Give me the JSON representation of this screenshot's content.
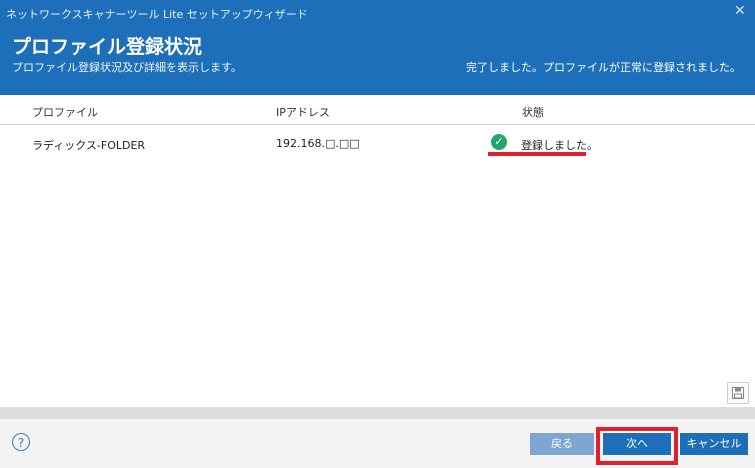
{
  "window": {
    "title": "ネットワークスキャナーツール Lite セットアップウィザード",
    "close_glyph": "✕"
  },
  "header": {
    "title": "プロファイル登録状況",
    "subtitle": "プロファイル登録状況及び詳細を表示します。",
    "status_message": "完了しました。プロファイルが正常に登録されました。"
  },
  "table": {
    "columns": [
      "プロファイル",
      "IPアドレス",
      "状態"
    ],
    "rows": [
      {
        "profile": "ラディックス-FOLDER",
        "ip": "192.168.□.□□",
        "status": "登録しました。",
        "status_icon": "check-circle-icon"
      }
    ]
  },
  "footer": {
    "help_glyph": "?",
    "back_label": "戻る",
    "next_label": "次へ",
    "cancel_label": "キャンセル"
  },
  "colors": {
    "header_bg": "#1c6fb8",
    "success": "#1fa66b",
    "highlight": "#e0202a",
    "button_primary": "#1c6fb8",
    "button_disabled": "#7da6d0"
  }
}
